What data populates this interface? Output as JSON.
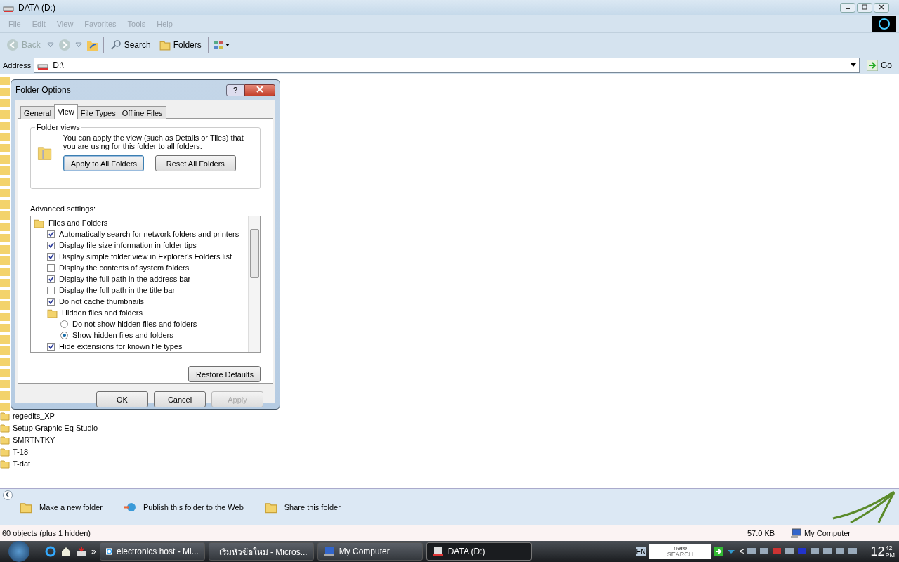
{
  "window": {
    "title": "DATA (D:)"
  },
  "menu": [
    {
      "label": "File"
    },
    {
      "label": "Edit"
    },
    {
      "label": "View"
    },
    {
      "label": "Favorites"
    },
    {
      "label": "Tools"
    },
    {
      "label": "Help"
    }
  ],
  "toolbar": {
    "back": {
      "label": "Back",
      "disabled": true
    },
    "search": {
      "label": "Search"
    },
    "folders": {
      "label": "Folders"
    }
  },
  "address": {
    "label": "Address",
    "value": "D:\\",
    "go": "Go"
  },
  "files": [
    {
      "name": "regedits_XP"
    },
    {
      "name": "Setup Graphic Eq Studio"
    },
    {
      "name": "SMRTNTKY"
    },
    {
      "name": "T-18"
    },
    {
      "name": "T-dat"
    }
  ],
  "dialog": {
    "title": "Folder Options",
    "help": "?",
    "tabs": [
      {
        "label": "General",
        "selected": false
      },
      {
        "label": "View",
        "selected": true
      },
      {
        "label": "File Types",
        "selected": false
      },
      {
        "label": "Offline Files",
        "selected": false
      }
    ],
    "folder_views": {
      "title": "Folder views",
      "text": "You can apply the view (such as Details or Tiles) that you are using for this folder to all folders.",
      "buttons": [
        {
          "label": "Apply to All Folders",
          "default": true
        },
        {
          "label": "Reset All Folders",
          "default": false
        }
      ]
    },
    "advanced_label": "Advanced settings:",
    "settings": [
      {
        "kind": "group",
        "label": "Files and Folders",
        "children": [
          {
            "kind": "checkbox",
            "label": "Automatically search for network folders and printers",
            "checked": true
          },
          {
            "kind": "checkbox",
            "label": "Display file size information in folder tips",
            "checked": true
          },
          {
            "kind": "checkbox",
            "label": "Display simple folder view in Explorer's Folders list",
            "checked": true
          },
          {
            "kind": "checkbox",
            "label": "Display the contents of system folders",
            "checked": false
          },
          {
            "kind": "checkbox",
            "label": "Display the full path in the address bar",
            "checked": true
          },
          {
            "kind": "checkbox",
            "label": "Display the full path in the title bar",
            "checked": false
          },
          {
            "kind": "checkbox",
            "label": "Do not cache thumbnails",
            "checked": true
          },
          {
            "kind": "group",
            "label": "Hidden files and folders",
            "children": [
              {
                "kind": "radio",
                "label": "Do not show hidden files and folders",
                "selected": false
              },
              {
                "kind": "radio",
                "label": "Show hidden files and folders",
                "selected": true
              }
            ]
          },
          {
            "kind": "checkbox",
            "label": "Hide extensions for known file types",
            "checked": true
          }
        ]
      }
    ],
    "restore": "Restore Defaults",
    "buttons": [
      {
        "label": "OK",
        "disabled": false
      },
      {
        "label": "Cancel",
        "disabled": false
      },
      {
        "label": "Apply",
        "disabled": true
      }
    ]
  },
  "tasks": [
    {
      "label": "Make a new folder"
    },
    {
      "label": "Publish this folder to the Web"
    },
    {
      "label": "Share this folder"
    }
  ],
  "status_bar": {
    "objects": "60 objects (plus 1 hidden)",
    "size": "57.0 KB",
    "zone": "My Computer"
  },
  "taskbar": {
    "overflow": "»",
    "buttons": [
      {
        "label": "electronics host - Mi...",
        "selected": false
      },
      {
        "label": "เริ่มหัวข้อใหม่ - Micros...",
        "selected": false
      },
      {
        "label": "My Computer",
        "selected": false
      },
      {
        "label": "DATA (D:)",
        "selected": true
      }
    ],
    "lang": "EN",
    "nero": "nero",
    "nero_sub": "SEARCH",
    "tray_chevron": "<",
    "clock": {
      "hour": "12",
      "minute": "42",
      "ampm": "PM"
    }
  }
}
